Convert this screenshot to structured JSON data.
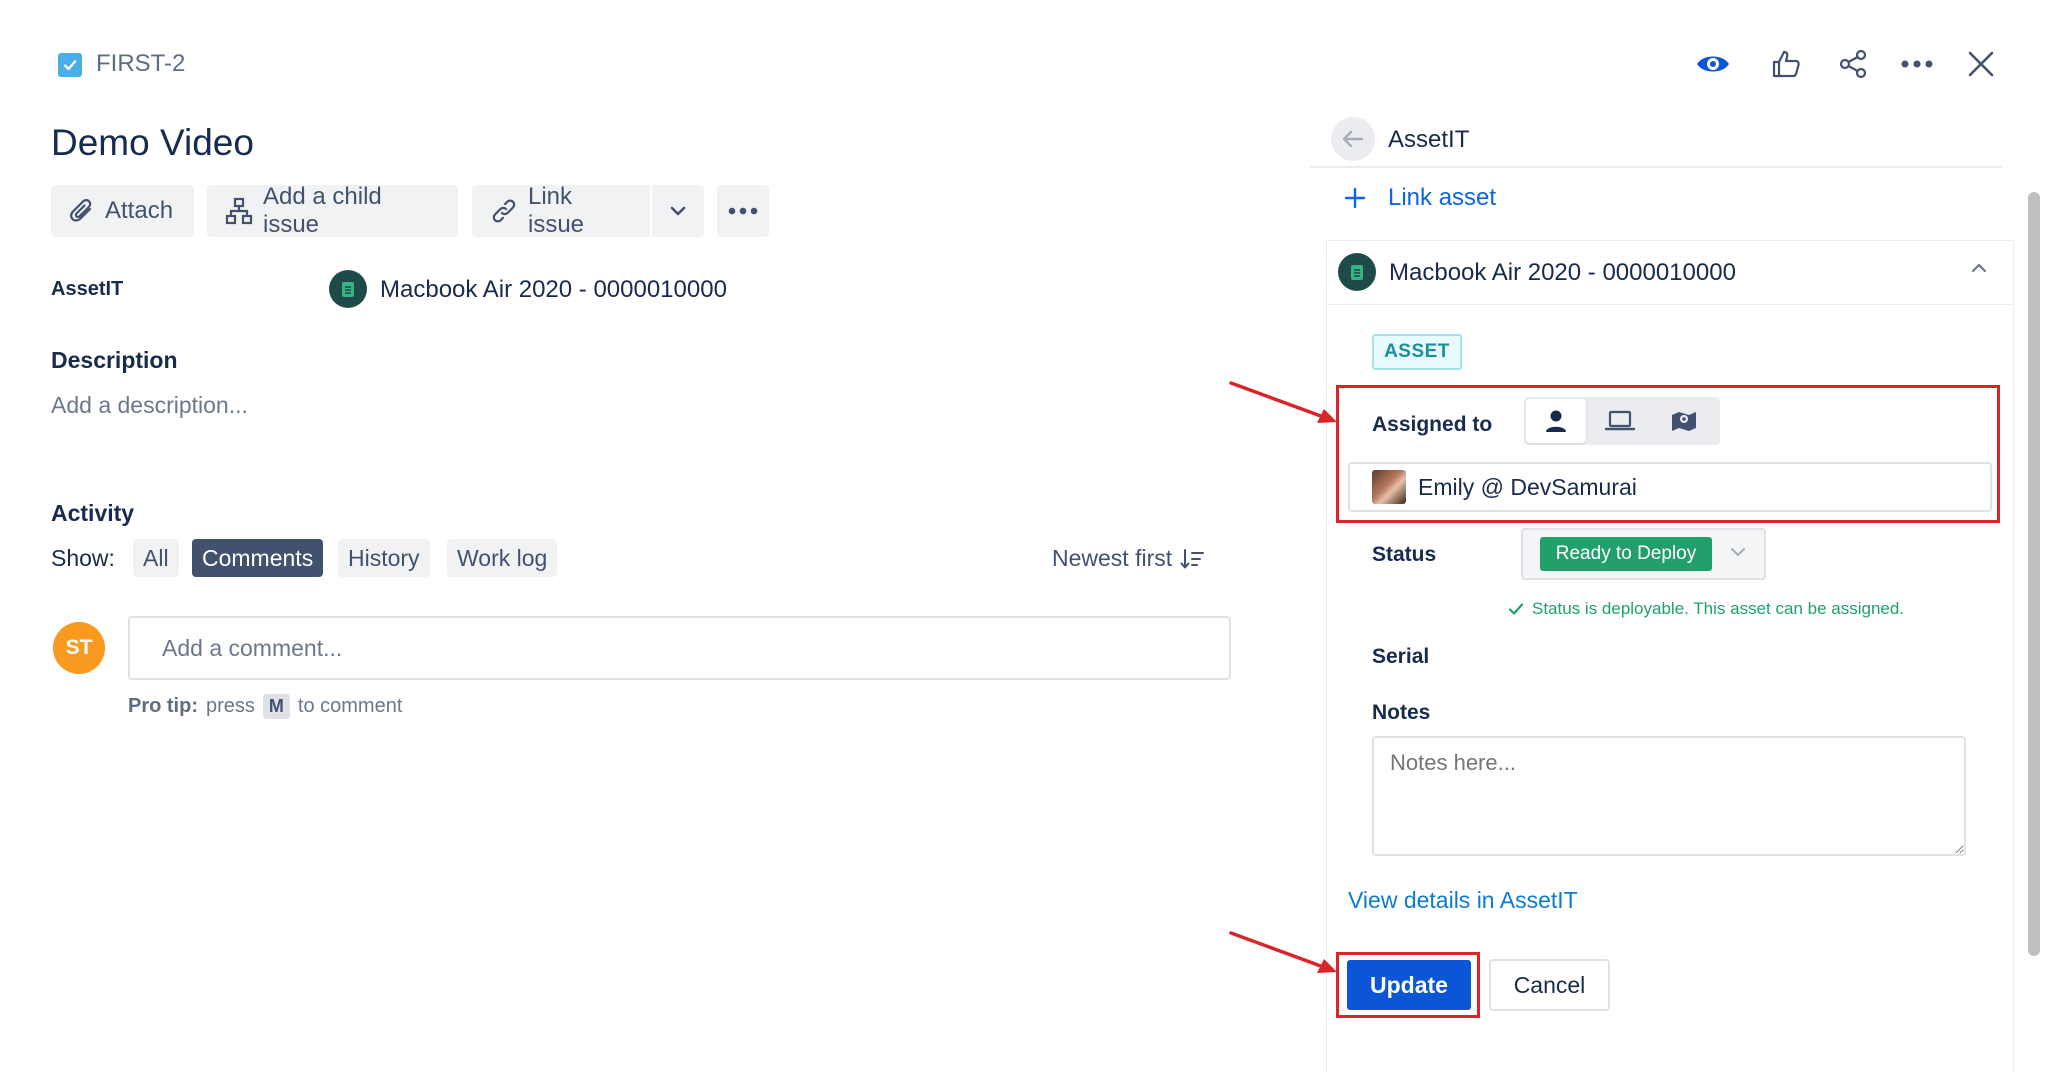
{
  "header": {
    "issue_key": "FIRST-2",
    "icons": [
      "eye-icon",
      "thumbs-up-icon",
      "share-icon",
      "more-icon",
      "close-icon"
    ]
  },
  "issue": {
    "title": "Demo Video",
    "toolbar": {
      "attach": "Attach",
      "add_child": "Add a child issue",
      "link_issue": "Link issue"
    },
    "asset_field": {
      "label": "AssetIT",
      "value": "Macbook Air 2020 - 0000010000"
    },
    "description": {
      "label": "Description",
      "placeholder": "Add a description..."
    },
    "activity": {
      "label": "Activity",
      "show_label": "Show:",
      "filters": [
        "All",
        "Comments",
        "History",
        "Work log"
      ],
      "active_filter": "Comments",
      "sort": "Newest first"
    },
    "comment": {
      "avatar_initials": "ST",
      "placeholder": "Add a comment...",
      "protip_bold": "Pro tip:",
      "protip_press": "press",
      "protip_key": "M",
      "protip_tail": "to comment"
    }
  },
  "panel": {
    "title": "AssetIT",
    "link_asset": "Link asset",
    "asset": {
      "name": "Macbook Air 2020 - 0000010000",
      "tag": "ASSET",
      "assigned_label": "Assigned to",
      "assign_types": [
        "user-icon",
        "laptop-icon",
        "map-icon"
      ],
      "assignee": "Emily @ DevSamurai",
      "status_label": "Status",
      "status_value": "Ready to Deploy",
      "status_note": "Status is deployable. This asset can be assigned.",
      "serial_label": "Serial",
      "notes_label": "Notes",
      "notes_placeholder": "Notes here...",
      "view_details": "View details in AssetIT",
      "update": "Update",
      "cancel": "Cancel"
    }
  },
  "colors": {
    "primary": "#0c55d6",
    "status_green": "#22a06b",
    "annotation_red": "#d9252a",
    "avatar_orange": "#f79a1f"
  }
}
